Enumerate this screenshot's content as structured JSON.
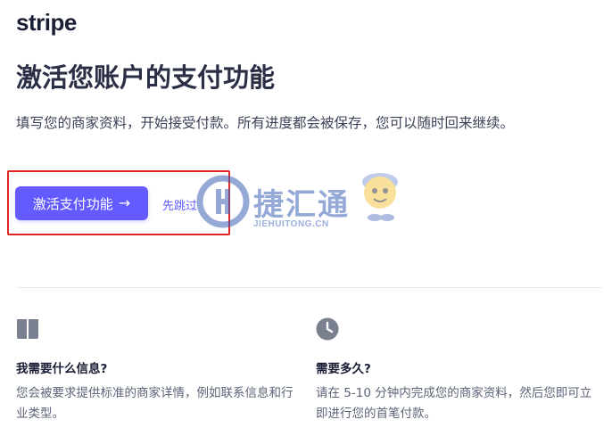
{
  "brand": {
    "logo_text": "stripe",
    "accent_color": "#635bff"
  },
  "title": "激活您账户的支付功能",
  "description": "填写您的商家资料，开始接受付款。所有进度都会被保存，您可以随时回来继续。",
  "actions": {
    "activate_label": "激活支付功能",
    "activate_icon": "arrow-right-icon",
    "skip_label": "先跳过"
  },
  "watermark": {
    "text": "捷汇通",
    "subtext": "JIEHUITONG.CN"
  },
  "features": [
    {
      "icon": "book-icon",
      "title": "我需要什么信息?",
      "description": "您会被要求提供标准的商家详情，例如联系信息和行业类型。"
    },
    {
      "icon": "clock-icon",
      "title": "需要多久?",
      "description": "请在 5-10 分钟内完成您的商家资料，然后您即可立即进行您的首笔付款。"
    }
  ]
}
